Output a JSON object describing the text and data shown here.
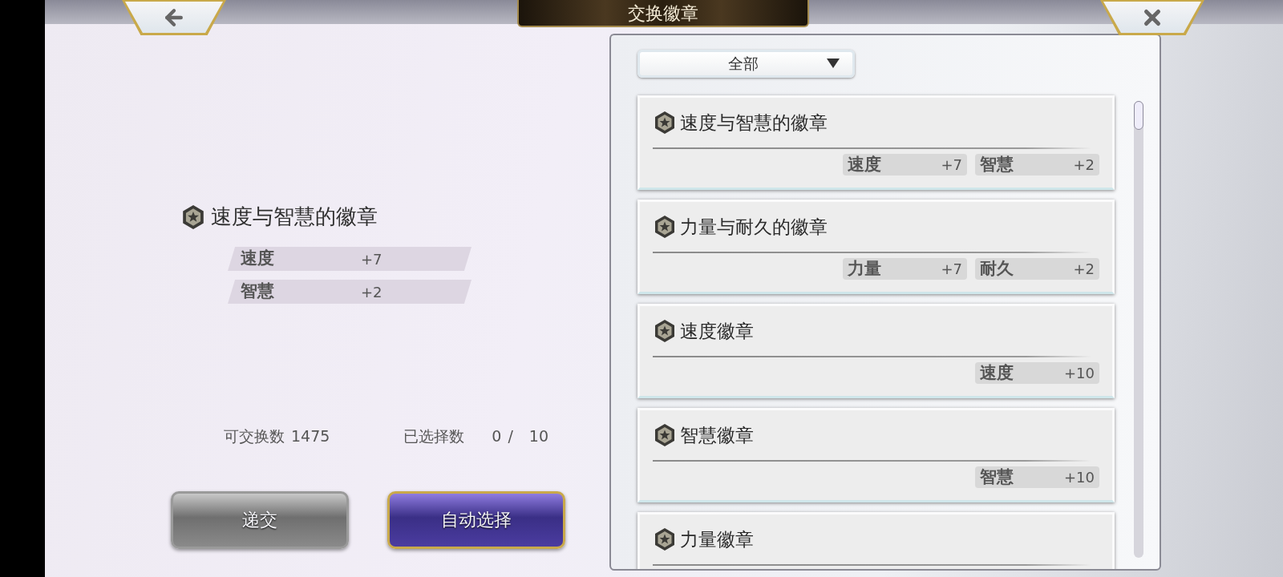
{
  "header": {
    "title": "交换徽章"
  },
  "selected_badge": {
    "name": "速度与智慧的徽章",
    "stats": [
      {
        "label": "速度",
        "value": "+7"
      },
      {
        "label": "智慧",
        "value": "+2"
      }
    ]
  },
  "exchangeable": {
    "label": "可交换数",
    "value": "1475"
  },
  "selected_count": {
    "label": "已选择数",
    "current": "0",
    "separator": "/",
    "max": "10"
  },
  "buttons": [
    {
      "label": "递交",
      "kind": "silver"
    },
    {
      "label": "自动选择",
      "kind": "purple"
    }
  ],
  "filter": {
    "value": "全部"
  },
  "badges": [
    {
      "name": "速度与智慧的徽章",
      "stats": [
        {
          "label": "速度",
          "value": "+7"
        },
        {
          "label": "智慧",
          "value": "+2"
        }
      ]
    },
    {
      "name": "力量与耐久的徽章",
      "stats": [
        {
          "label": "力量",
          "value": "+7"
        },
        {
          "label": "耐久",
          "value": "+2"
        }
      ]
    },
    {
      "name": "速度徽章",
      "stats": [
        {
          "label": "速度",
          "value": "+10"
        }
      ]
    },
    {
      "name": "智慧徽章",
      "stats": [
        {
          "label": "智慧",
          "value": "+10"
        }
      ]
    },
    {
      "name": "力量徽章"
    }
  ]
}
